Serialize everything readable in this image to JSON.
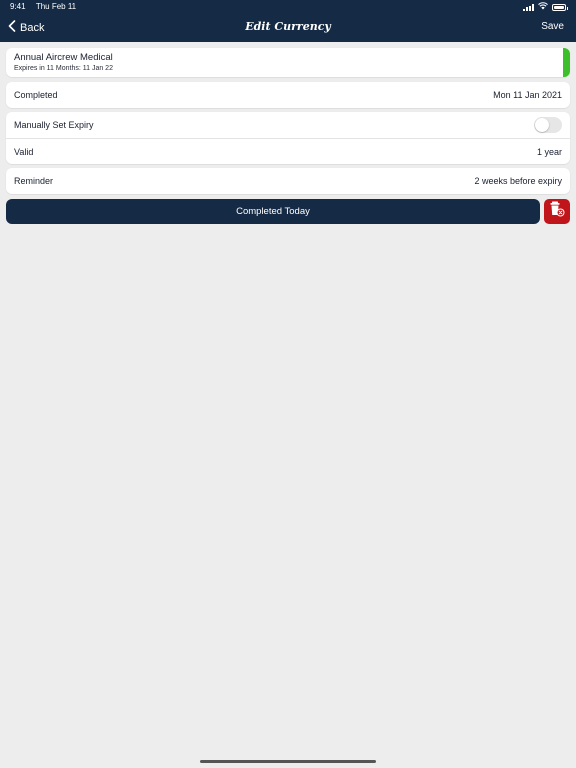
{
  "status_bar": {
    "time": "9:41",
    "date": "Thu Feb 11",
    "icons": [
      "signal-icon",
      "wifi-icon",
      "battery-icon"
    ],
    "battery_level": 1.0
  },
  "nav": {
    "back_label": "Back",
    "title": "Edit Currency",
    "save_label": "Save"
  },
  "currency": {
    "name": "Annual Aircrew Medical",
    "expiry_text": "Expires in 11 Months: 11 Jan 22",
    "status_color": "#3cbf2a"
  },
  "completed": {
    "label": "Completed",
    "value": "Mon 11 Jan 2021"
  },
  "manual_expiry": {
    "label": "Manually Set Expiry",
    "enabled": false
  },
  "valid": {
    "label": "Valid",
    "value": "1 year"
  },
  "reminder": {
    "label": "Reminder",
    "value": "2 weeks before expiry"
  },
  "actions": {
    "completed_today_label": "Completed Today",
    "delete_icon": "trash-icon"
  },
  "colors": {
    "nav_background": "#152a45",
    "page_background": "#ededed",
    "delete_button": "#c0161b"
  }
}
